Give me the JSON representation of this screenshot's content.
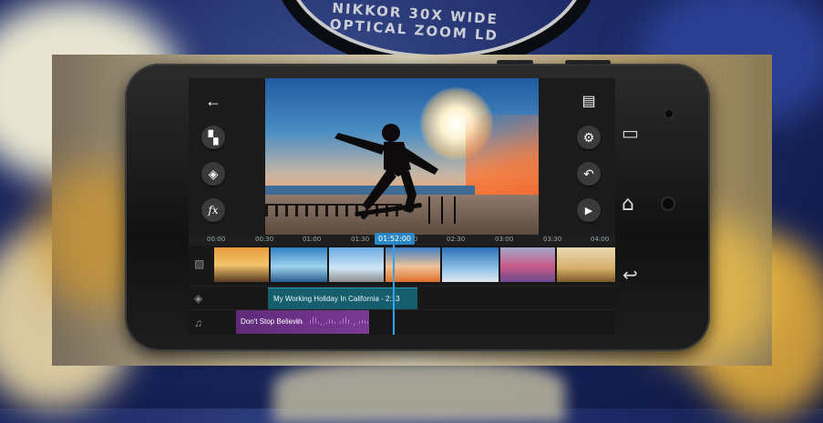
{
  "background": {
    "lens_text": "NIKKOR 30X WIDE OPTICAL ZOOM LD"
  },
  "editor": {
    "left_tools": [
      {
        "icon": "back-arrow-icon",
        "glyph": "←"
      },
      {
        "icon": "media-add-icon",
        "glyph": "▚"
      },
      {
        "icon": "layers-icon",
        "glyph": "◈"
      },
      {
        "icon": "fx-icon",
        "glyph": "fx"
      }
    ],
    "right_tools": [
      {
        "icon": "export-icon",
        "glyph": "▤"
      },
      {
        "icon": "settings-gear-icon",
        "glyph": "⚙"
      },
      {
        "icon": "undo-icon",
        "glyph": "↶"
      },
      {
        "icon": "play-icon",
        "glyph": "▶"
      }
    ],
    "timeline": {
      "ticks": [
        "00:00",
        "00:30",
        "01:00",
        "01:30",
        "02:00",
        "02:30",
        "03:00",
        "03:30",
        "04:00"
      ],
      "current_time": "01:52:00"
    },
    "text_clip": "My Working Holiday In California - 2:13",
    "audio_clip": "Don't Stop Believin"
  },
  "phone_nav": {
    "recent": "▭",
    "home": "⌂",
    "back": "↩"
  }
}
